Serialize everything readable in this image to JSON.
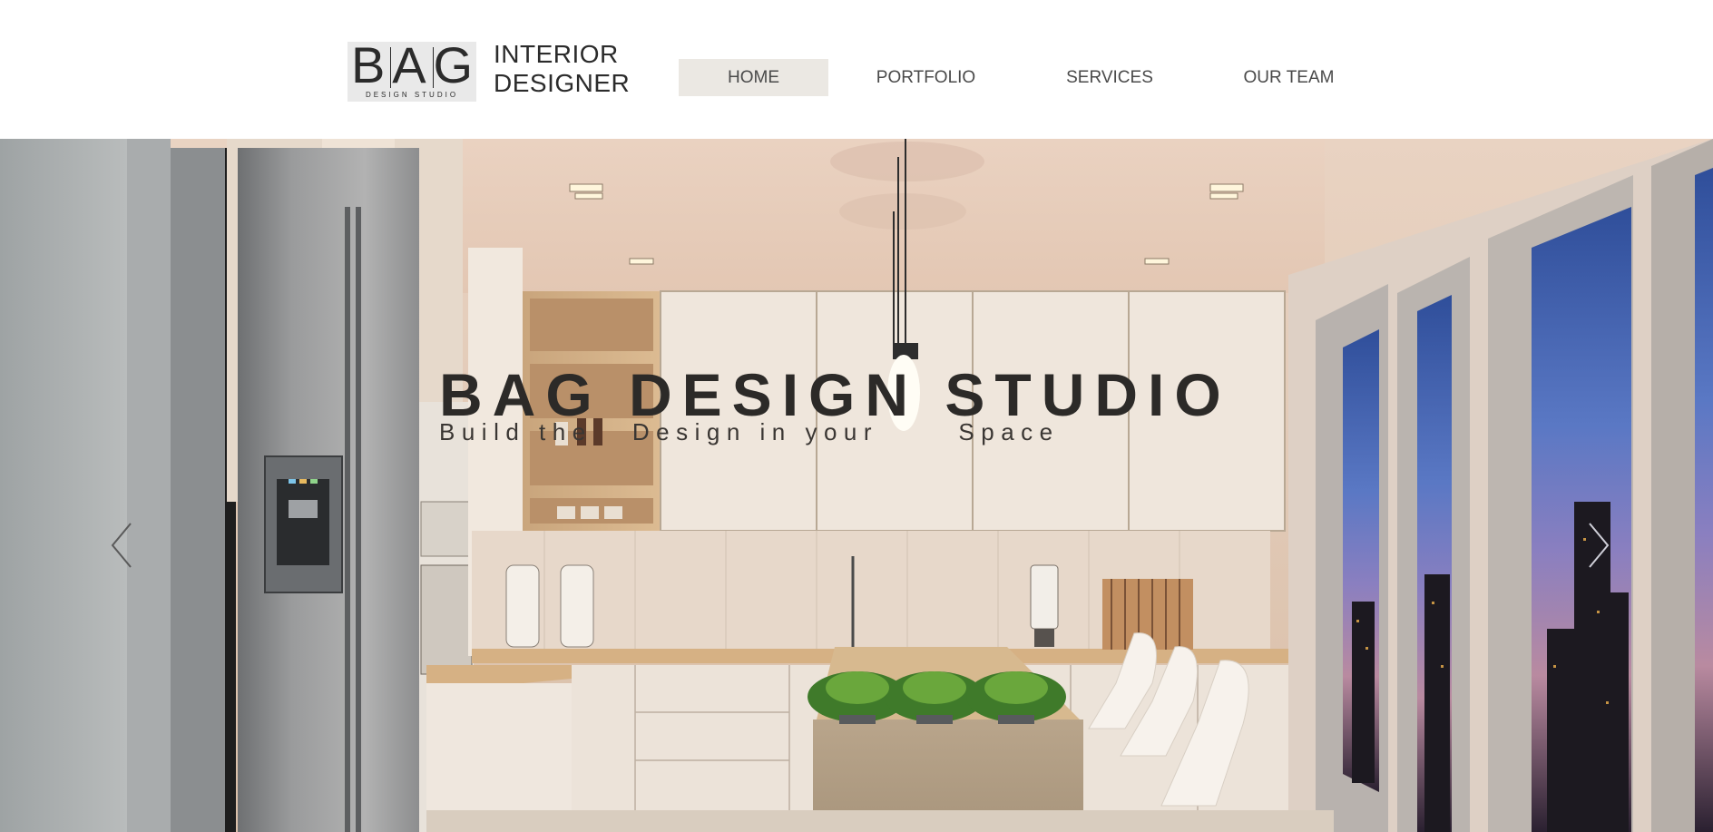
{
  "logo": {
    "letters": [
      "B",
      "A",
      "G"
    ],
    "subtitle": "DESIGN STUDIO",
    "name_line1": "INTERIOR",
    "name_line2": "DESIGNER"
  },
  "nav": {
    "items": [
      {
        "label": "HOME",
        "active": true
      },
      {
        "label": "PORTFOLIO",
        "active": false
      },
      {
        "label": "SERVICES",
        "active": false
      },
      {
        "label": "OUR TEAM",
        "active": false
      }
    ]
  },
  "hero": {
    "title": "BAG DESIGN STUDIO",
    "subtitle": "Build the   Design in your      Space",
    "prev_icon": "chevron-left-icon",
    "next_icon": "chevron-right-icon"
  },
  "colors": {
    "text_dark": "#2b2b2b",
    "nav_active_bg": "#ebe8e3",
    "nav_text": "#4a4a4a"
  }
}
